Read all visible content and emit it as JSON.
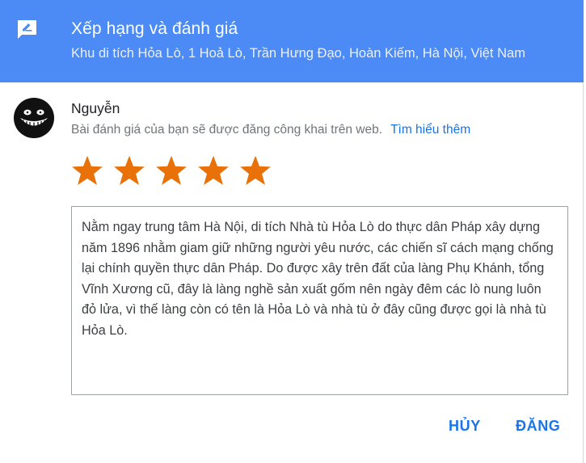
{
  "header": {
    "icon": "rate-review-icon",
    "title": "Xếp hạng và đánh giá",
    "subtitle": "Khu di tích Hỏa Lò, 1 Hoả Lò, Trần Hưng Đạo, Hoàn Kiếm, Hà Nội, Việt Nam",
    "background_color": "#4c8bf5"
  },
  "user": {
    "avatar_icon": "grinning-face-avatar",
    "name": "Nguyễn"
  },
  "notice": {
    "text": "Bài đánh giá của bạn sẽ được đăng công khai trên web.",
    "link": "Tìm hiểu thêm"
  },
  "rating": {
    "value": 5,
    "max": 5,
    "star_color": "#e8710a"
  },
  "review": {
    "text": "Nằm ngay trung tâm Hà Nội, di tích Nhà tù Hỏa Lò do thực dân Pháp xây dựng năm 1896 nhằm giam giữ những người yêu nước, các chiến sĩ cách mạng chống lại chính quyền thực dân Pháp. Do được xây trên đất của làng Phụ Khánh, tổng Vĩnh Xương cũ, đây là làng nghề sản xuất gốm nên ngày đêm các lò nung luôn đỏ lửa, vì thế làng còn có tên là Hỏa Lò và nhà tù ở đây cũng được gọi là nhà tù Hỏa Lò."
  },
  "actions": {
    "cancel_label": "HỦY",
    "post_label": "ĐĂNG",
    "accent_color": "#1a73e8"
  }
}
